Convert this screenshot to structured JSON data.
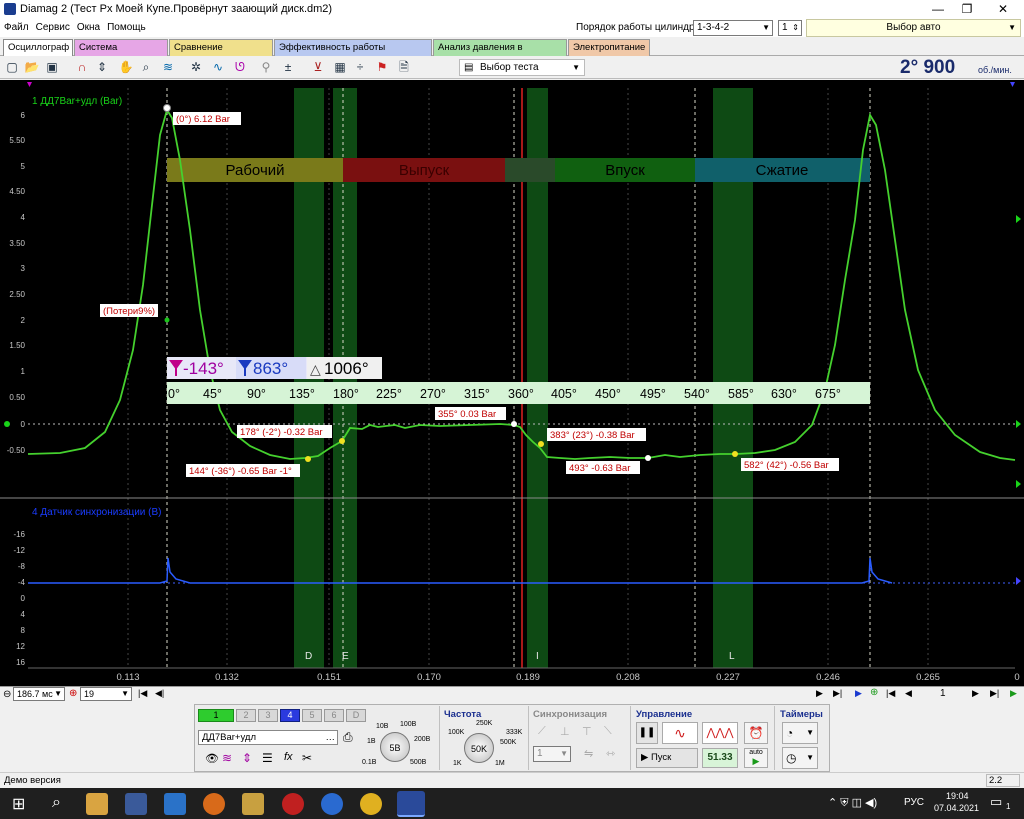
{
  "window": {
    "title": "Diamag 2 (Тест Px Моей Купе.Провёрнут заающий диск.dm2)",
    "minimize": "—",
    "maximize": "❐",
    "close": "✕"
  },
  "menu": [
    "Файл",
    "Сервис",
    "Окна",
    "Помощь"
  ],
  "cylinders": {
    "label": "Порядок работы цилиндров",
    "order": "1-3-4-2",
    "number": "1",
    "auto": "Выбор авто"
  },
  "tabs": [
    {
      "label": "Осциллограф",
      "color": "#ffffff"
    },
    {
      "label": "Система зажигания",
      "color": "#e6a6e6"
    },
    {
      "label": "Сравнение цилиндров",
      "color": "#f0e08c"
    },
    {
      "label": "Эффективность работы цилиндров",
      "color": "#b8c8f0"
    },
    {
      "label": "Анализ давления в цилиндре",
      "color": "#a8e0a8"
    },
    {
      "label": "Электропитание",
      "color": "#f0c8a8"
    }
  ],
  "toolbar": {
    "test_select": "Выбор теста",
    "rpm_value": "2° 900",
    "rpm_unit": "об./мин."
  },
  "scope": {
    "channel1_label": "1 ДД7Bar+удл (Bar)",
    "channel4_label": "4 Датчик синхронизации (В)",
    "y_ticks_top": [
      "6",
      "5.50",
      "5",
      "4.50",
      "4",
      "3.50",
      "3",
      "2.50",
      "2",
      "1.50",
      "1",
      "0.50",
      "0",
      "-0.50"
    ],
    "y_ticks_bottom": [
      "-16",
      "-12",
      "-8",
      "-4",
      "0",
      "4",
      "8",
      "12",
      "16"
    ],
    "x_ticks": [
      "0.113",
      "0.132",
      "0.151",
      "0.170",
      "0.189",
      "0.208",
      "0.227",
      "0.246",
      "0.265",
      "0"
    ],
    "phases": [
      {
        "label": "Рабочий",
        "color": "#7a7a1a"
      },
      {
        "label": "Выпуск",
        "color": "#7a1010"
      },
      {
        "label": "",
        "color": "#2a4a2a"
      },
      {
        "label": "Впуск",
        "color": "#106010"
      },
      {
        "label": "Сжатие",
        "color": "#10606a"
      }
    ],
    "cursor_a": "-143°",
    "cursor_b": "863°",
    "cursor_delta": "1006°",
    "angle_ticks": [
      "0°",
      "45°",
      "90°",
      "135°",
      "180°",
      "225°",
      "270°",
      "315°",
      "360°",
      "405°",
      "450°",
      "495°",
      "540°",
      "585°",
      "630°",
      "675°"
    ],
    "markers": [
      {
        "label": "(0°) 6.12 Bar"
      },
      {
        "label": "(Потери9%)"
      },
      {
        "label": "178° (-2°) -0.32 Bar"
      },
      {
        "label": "144° (-36°) -0.65 Bar -1°"
      },
      {
        "label": "355° 0.03 Bar"
      },
      {
        "label": "383° (23°) -0.38 Bar"
      },
      {
        "label": "493° -0.63 Bar"
      },
      {
        "label": "582° (42°) -0.56 Bar"
      }
    ],
    "zone_letters": [
      "D",
      "E",
      "I",
      "L"
    ]
  },
  "bottom": {
    "time_div": "186.7 мс",
    "channel": "19",
    "page": "1"
  },
  "panel": {
    "channels": [
      "1",
      "2",
      "3",
      "4",
      "5",
      "6",
      "D"
    ],
    "channel_name": "ДД7Bar+удл",
    "volt_knob": "5В",
    "volt_marks": [
      "10В",
      "100В",
      "1В",
      "200В",
      "0.1В",
      "500В"
    ],
    "freq_title": "Частота",
    "freq_knob": "50K",
    "freq_marks": [
      "250K",
      "100K",
      "333K",
      "500K",
      "1K",
      "1M"
    ],
    "sync_title": "Синхронизация",
    "sync_value": "1",
    "control_title": "Управление",
    "start_label": "Пуск",
    "rate": "51.33",
    "auto_label": "auto",
    "timers_title": "Таймеры"
  },
  "status": {
    "left": "Демо версия",
    "right": "2.2"
  },
  "taskbar": {
    "lang": "РУС",
    "time": "19:04",
    "date": "07.04.2021",
    "notif": "1"
  }
}
